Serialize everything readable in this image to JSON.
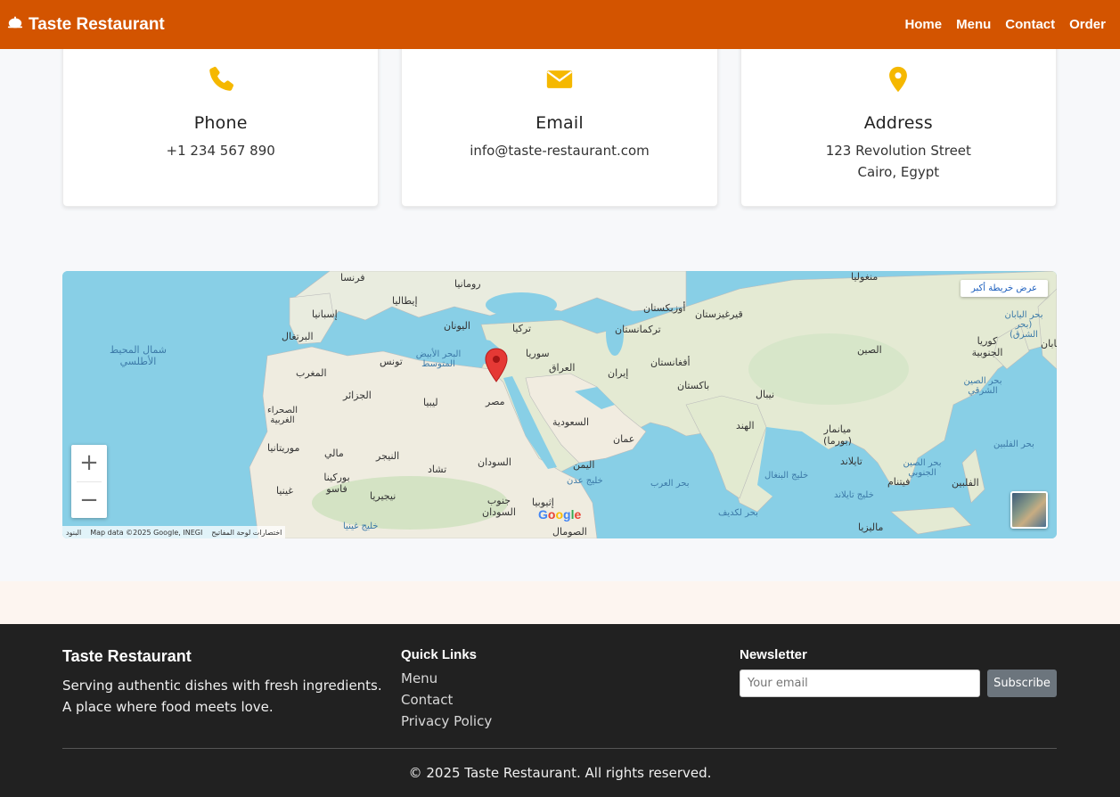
{
  "nav": {
    "brand": "Taste Restaurant",
    "links": [
      "Home",
      "Menu",
      "Contact",
      "Order"
    ]
  },
  "contact_cards": [
    {
      "icon": "phone-icon",
      "title": "Phone",
      "line1": "+1 234 567 890",
      "line2": ""
    },
    {
      "icon": "envelope-icon",
      "title": "Email",
      "line1": "info@taste-restaurant.com",
      "line2": ""
    },
    {
      "icon": "map-marker-icon",
      "title": "Address",
      "line1": "123 Revolution Street",
      "line2": "Cairo, Egypt"
    }
  ],
  "colors": {
    "nav_bg": "#d35400",
    "icon_accent": "#f5b800",
    "footer_bg": "#212121"
  },
  "map": {
    "view_larger_label": "عرض خريطة أكبر",
    "zoom_in": "+",
    "zoom_out": "−",
    "attribution_keys": "اختصارات لوحة المفاتيح",
    "attribution_data": "Map data ©2025 Google, INEGI",
    "attribution_terms": "البنود",
    "google": "Google",
    "labels": {
      "egypt": "مصر",
      "libya": "ليبيا",
      "algeria": "الجزائر",
      "morocco": "المغرب",
      "western_sahara": "الصحراء الغربية",
      "mauritania": "موريتانيا",
      "mali": "مالي",
      "niger": "النيجر",
      "chad": "تشاد",
      "sudan": "السودان",
      "south_sudan": "جنوب السودان",
      "ethiopia": "إثيوبيا",
      "somalia": "الصومال",
      "yemen": "اليمن",
      "oman": "عمان",
      "saudi": "السعودية",
      "iraq": "العراق",
      "iran": "إيران",
      "syria": "سوريا",
      "turkey": "تركيا",
      "greece": "اليونان",
      "italy": "إيطاليا",
      "spain": "إسبانيا",
      "portugal": "البرتغال",
      "france": "فرنسا",
      "romania": "رومانيا",
      "tunisia": "تونس",
      "nigeria": "نيجيريا",
      "burkina": "بوركينا فاسو",
      "ghana": "غينيا",
      "afghanistan": "أفغانستان",
      "pakistan": "باكستان",
      "turkmenistan": "تركمانستان",
      "uzbekistan": "أوزبكستان",
      "kyrgyzstan": "قيرغيزستان",
      "india": "الهند",
      "nepal": "نيبال",
      "myanmar": "ميانمار (بورما)",
      "thailand": "تايلاند",
      "vietnam": "فيتنام",
      "philippines": "الفلبين",
      "malaysia": "ماليزيا",
      "china": "الصين",
      "mongolia": "منغوليا",
      "korea": "كوريا الجنوبية",
      "japan": "اليابان",
      "atlantic": "شمال المحيط الأطلسي",
      "med": "البحر الأبيض المتوسط",
      "arabian_sea": "بحر العرب",
      "bengal": "خليج البنغال",
      "aden": "خليج عدن",
      "guinea_gulf": "خليج غينيا",
      "laccadive": "بحر لكديف",
      "andaman": "خليج تايلاند",
      "scs": "بحر الصين الجنوبي",
      "ecs": "بحر الصين الشرقي",
      "philippine_sea": "بحر الفلبين",
      "japan_sea": "بحر اليابان (بحر الشرق)"
    }
  },
  "footer": {
    "brand": "Taste Restaurant",
    "description": "Serving authentic dishes with fresh ingredients. A place where food meets love.",
    "quick_links_title": "Quick Links",
    "quick_links": [
      "Menu",
      "Contact",
      "Privacy Policy"
    ],
    "newsletter_title": "Newsletter",
    "email_placeholder": "Your email",
    "subscribe_label": "Subscribe",
    "copyright": "© 2025 Taste Restaurant. All rights reserved."
  }
}
